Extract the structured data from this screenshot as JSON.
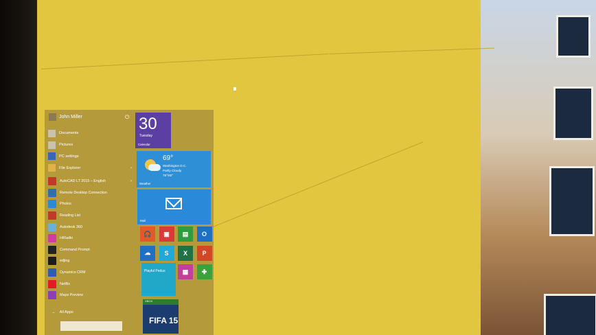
{
  "start_menu": {
    "user": "John Miller",
    "user_items": [
      {
        "label": "Documents",
        "icon": "documents-icon",
        "color": "#c9c3ad"
      },
      {
        "label": "Pictures",
        "icon": "pictures-icon",
        "color": "#c9c3ad"
      },
      {
        "label": "PC settings",
        "icon": "gear-icon",
        "color": "#3a66b8"
      },
      {
        "label": "File Explorer",
        "icon": "folder-icon",
        "color": "#e0b24a",
        "arrow": "›"
      }
    ],
    "apps": [
      {
        "label": "AutoCAD LT 2015 – English",
        "icon": "autocad-icon",
        "color": "#c0392b",
        "arrow": "›"
      },
      {
        "label": "Remote Desktop Connection",
        "icon": "remote-desktop-icon",
        "color": "#2d6fb5"
      },
      {
        "label": "Photos",
        "icon": "photos-icon",
        "color": "#2a8ad8"
      },
      {
        "label": "Reading List",
        "icon": "reading-list-icon",
        "color": "#c0392b"
      },
      {
        "label": "Autodesk 360",
        "icon": "autodesk-icon",
        "color": "#6ab0d8"
      },
      {
        "label": "HiRadio",
        "icon": "radio-icon",
        "color": "#d23ca1"
      },
      {
        "label": "Command Prompt",
        "icon": "command-prompt-icon",
        "color": "#222222"
      },
      {
        "label": "edjing",
        "icon": "edjing-icon",
        "color": "#1c1c1c"
      },
      {
        "label": "Dynamics CRM",
        "icon": "dynamics-icon",
        "color": "#2d5db0"
      },
      {
        "label": "Netflix",
        "icon": "netflix-icon",
        "color": "#e21b24"
      },
      {
        "label": "Maps Preview",
        "icon": "maps-icon",
        "color": "#8c3fb5"
      }
    ],
    "all_apps": "All Apps",
    "all_apps_arrow": "→"
  },
  "tiles": {
    "calendar": {
      "number": "30",
      "day": "Tuesday",
      "label": "Calendar"
    },
    "weather": {
      "temp": "69°",
      "location": "Washington D.C.",
      "condition": "Partly Cloudy",
      "range": "78°/60°",
      "label": "Weather"
    },
    "mail": {
      "label": "Mail"
    },
    "small": [
      {
        "icon": "headphones-icon",
        "color": "#e35a2a",
        "glyph": "🎧"
      },
      {
        "icon": "video-icon",
        "color": "#d83a3a",
        "glyph": "▣"
      },
      {
        "icon": "store-icon",
        "color": "#2e9c3f",
        "glyph": "▤"
      },
      {
        "icon": "outlook-icon",
        "color": "#1f6fc5",
        "glyph": "O"
      },
      {
        "icon": "onedrive-icon",
        "color": "#1f6fc5",
        "glyph": "☁"
      },
      {
        "icon": "skype-icon",
        "color": "#21a8d8",
        "glyph": "S"
      },
      {
        "icon": "excel-icon",
        "color": "#207245",
        "glyph": "X"
      },
      {
        "icon": "powerpoint-icon",
        "color": "#d24726",
        "glyph": "P"
      },
      {
        "icon": "onenote-icon",
        "color": "#b03a9c",
        "glyph": "N"
      },
      {
        "icon": "word-icon",
        "color": "#2b5797",
        "glyph": "W"
      },
      {
        "icon": "photo-tile-icon",
        "color": "#c23f9c",
        "glyph": "▦"
      },
      {
        "icon": "games-icon",
        "color": "#3aa23a",
        "glyph": "✚"
      }
    ],
    "people": {
      "label": "Playful Pedus"
    },
    "xbox": {
      "header": "XBOX",
      "title": "FIFA 15"
    }
  },
  "colors": {
    "wall": "#e3c63f",
    "start_bg": "#b59a3c",
    "accent": "#2b89d9"
  }
}
